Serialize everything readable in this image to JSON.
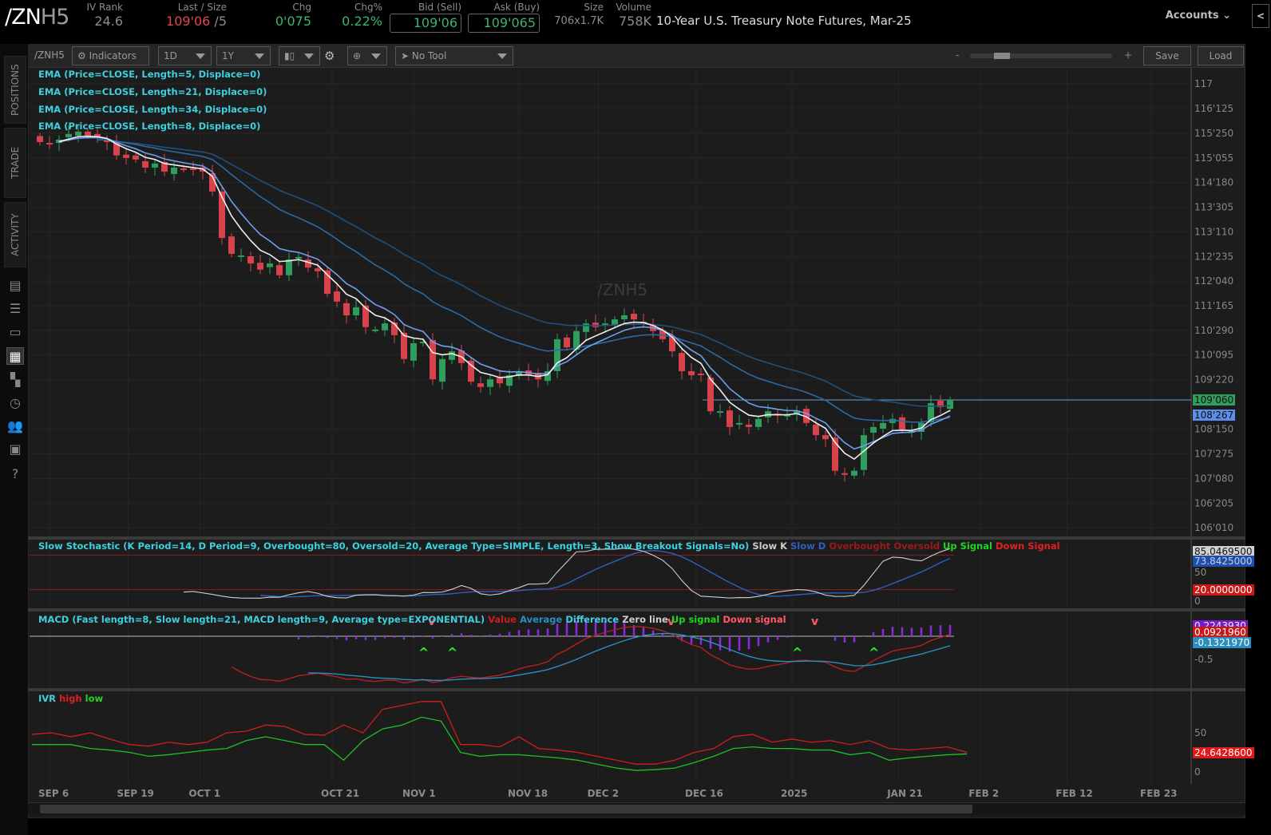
{
  "header": {
    "symbol_main": "/ZN",
    "symbol_suffix": "H5",
    "fields": [
      {
        "label": "IV Rank",
        "value": "24.6"
      },
      {
        "label": "Last / Size",
        "value": "109'06",
        "value2": " /5"
      },
      {
        "label": "Chg",
        "value": "0'075"
      },
      {
        "label": "Chg%",
        "value": "0.22%"
      },
      {
        "label": "Bid (Sell)",
        "value": "109'06"
      },
      {
        "label": "Ask (Buy)",
        "value": "109'065"
      },
      {
        "label": "Size",
        "value": "706x1.7K"
      },
      {
        "label": "Volume",
        "value": "758K"
      }
    ],
    "description": "10-Year U.S. Treasury Note Futures, Mar-25",
    "accounts": "Accounts",
    "collapse": "<"
  },
  "sidebar": {
    "tabs": [
      "POSITIONS",
      "TRADE",
      "ACTIVITY"
    ],
    "icons": [
      "chart-report-icon",
      "list-icon",
      "tv-icon",
      "chart-grid-icon",
      "layout-grid-icon",
      "history-clock-icon",
      "community-icon",
      "calendar-icon",
      "help-icon"
    ]
  },
  "toolbar": {
    "symbol": "/ZNH5",
    "indicators": "Indicators",
    "aggregation": "1D",
    "timeframe": "1Y",
    "drawing_tool": "No Tool",
    "zoom_minus": "-",
    "zoom_plus": "+",
    "zoom_level": 0.2,
    "save": "Save",
    "load": "Load"
  },
  "studies": {
    "ema": [
      "EMA (Price=CLOSE, Length=5, Displace=0)",
      "EMA (Price=CLOSE, Length=21, Displace=0)",
      "EMA (Price=CLOSE, Length=34, Displace=0)",
      "EMA (Price=CLOSE, Length=8, Displace=0)"
    ],
    "stoch": {
      "title": "Slow Stochastic (K Period=14, D Period=9, Overbought=80, Oversold=20, Average Type=SIMPLE, Length=3, Show Breakout Signals=No)",
      "slow_k": "Slow K",
      "slow_d": "Slow D",
      "overbought": "Overbought",
      "oversold": "Oversold",
      "up": "Up Signal",
      "down": "Down Signal",
      "tags": [
        "85.0469500",
        "73.8425000",
        "20.0000000"
      ],
      "ticks": [
        "50",
        "0"
      ]
    },
    "macd": {
      "title": "MACD (Fast length=8, Slow length=21, MACD length=9, Average type=EXPONENTIAL)",
      "value": "Value",
      "average": "Average",
      "diff": "Difference",
      "zero": "Zero line",
      "up": "Up signal",
      "down": "Down signal",
      "tags": [
        "0.2243930",
        "0.0921960",
        "-0.1321970"
      ],
      "ticks": [
        "-0.5"
      ]
    },
    "ivr": {
      "title": "IVR",
      "high": "high",
      "low": "low",
      "tags": [
        "24.6428600"
      ],
      "ticks": [
        "50",
        "0"
      ]
    }
  },
  "colors": {
    "up": "#2f9e5c",
    "down": "#d8434b",
    "ema5": "#f0f0f0",
    "ema8": "#6f9ff0",
    "ema21": "#2d6aa3",
    "ema34": "#1f4f7c"
  },
  "chart_data": {
    "type": "candlestick",
    "symbol_watermark": "/ZNH5",
    "last_price_tag": "109'060",
    "ema_tag": "108'267",
    "last_price": 109.19,
    "price_ticks": [
      {
        "label": "117",
        "v": 117
      },
      {
        "label": "116'125",
        "v": 116.39
      },
      {
        "label": "115'250",
        "v": 115.78
      },
      {
        "label": "115'055",
        "v": 115.17
      },
      {
        "label": "114'180",
        "v": 114.56
      },
      {
        "label": "113'305",
        "v": 113.95
      },
      {
        "label": "113'110",
        "v": 113.34
      },
      {
        "label": "112'235",
        "v": 112.73
      },
      {
        "label": "112'040",
        "v": 112.125
      },
      {
        "label": "111'165",
        "v": 111.52
      },
      {
        "label": "110'290",
        "v": 110.91
      },
      {
        "label": "110'095",
        "v": 110.3
      },
      {
        "label": "109'220",
        "v": 109.69
      },
      {
        "label": "108'150",
        "v": 108.47
      },
      {
        "label": "107'275",
        "v": 107.86
      },
      {
        "label": "107'080",
        "v": 107.25
      },
      {
        "label": "106'205",
        "v": 106.64
      },
      {
        "label": "106'010",
        "v": 106.03
      }
    ],
    "date_ticks": [
      {
        "label": "SEP 6",
        "i": 1
      },
      {
        "label": "SEP 19",
        "i": 9.2
      },
      {
        "label": "OCT 1",
        "i": 16.7
      },
      {
        "label": "OCT 21",
        "i": 30.5
      },
      {
        "label": "NOV 1",
        "i": 39
      },
      {
        "label": "NOV 18",
        "i": 50
      },
      {
        "label": "DEC 2",
        "i": 58.3
      },
      {
        "label": "DEC 16",
        "i": 68.5
      },
      {
        "label": "2025",
        "i": 78.5
      },
      {
        "label": "JAN 21",
        "i": 89.6
      },
      {
        "label": "FEB 2",
        "i": 98.1
      },
      {
        "label": "FEB 12",
        "i": 107.2
      },
      {
        "label": "FEB 23",
        "i": 116
      }
    ],
    "closes": [
      115.56,
      115.52,
      115.62,
      115.76,
      115.82,
      115.72,
      115.68,
      115.56,
      115.23,
      115.17,
      115.13,
      114.93,
      115.03,
      114.83,
      114.93,
      114.89,
      114.87,
      114.83,
      114.34,
      113.19,
      112.8,
      112.76,
      112.56,
      112.41,
      112.56,
      112.27,
      112.66,
      112.72,
      112.46,
      112.37,
      111.81,
      111.62,
      111.28,
      111.48,
      110.99,
      110.93,
      111.08,
      110.79,
      110.2,
      110.59,
      110.63,
      109.7,
      110.2,
      110.39,
      110.1,
      109.64,
      109.51,
      109.7,
      109.6,
      109.8,
      109.9,
      109.8,
      109.7,
      109.9,
      110.69,
      110.49,
      110.89,
      111.08,
      110.99,
      111.08,
      111.18,
      111.28,
      111.18,
      111.08,
      110.89,
      110.69,
      110.39,
      109.9,
      109.8,
      109.8,
      108.91,
      108.91,
      108.52,
      108.62,
      108.52,
      108.72,
      108.91,
      108.82,
      108.82,
      108.91,
      108.62,
      108.32,
      108.22,
      107.44,
      107.34,
      107.44,
      108.32,
      108.52,
      108.62,
      108.72,
      108.46,
      108.42,
      108.62,
      109.11,
      109.01,
      109.19
    ],
    "ivr_high": [
      48,
      50,
      45,
      50,
      42,
      35,
      33,
      38,
      35,
      38,
      50,
      52,
      60,
      58,
      48,
      47,
      60,
      50,
      80,
      85,
      90,
      90,
      35,
      35,
      32,
      45,
      30,
      28,
      25,
      20,
      15,
      10,
      10,
      15,
      25,
      30,
      45,
      48,
      38,
      42,
      38,
      40,
      35,
      40,
      30,
      28,
      30,
      32,
      25
    ],
    "ivr_low": [
      35,
      35,
      35,
      30,
      28,
      25,
      20,
      22,
      25,
      28,
      30,
      40,
      45,
      40,
      35,
      35,
      15,
      40,
      55,
      60,
      70,
      65,
      25,
      20,
      22,
      22,
      20,
      18,
      15,
      10,
      5,
      2,
      3,
      5,
      12,
      20,
      30,
      32,
      30,
      30,
      28,
      28,
      22,
      25,
      15,
      18,
      20,
      22,
      23
    ],
    "stoch_range": [
      0,
      100
    ],
    "macd_range": [
      -1.1,
      0.45
    ],
    "ivr_range": [
      0,
      100
    ]
  }
}
